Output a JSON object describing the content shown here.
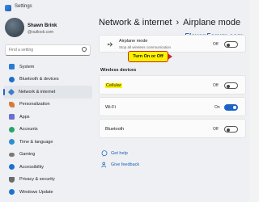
{
  "window": {
    "title": "Settings"
  },
  "user": {
    "name": "Shawn Brink",
    "email": "@outlook.com"
  },
  "search": {
    "placeholder": "Find a setting"
  },
  "sidebar": {
    "items": [
      {
        "label": "System",
        "icon": "system-icon",
        "color": "#2b7bd6"
      },
      {
        "label": "Bluetooth & devices",
        "icon": "bluetooth-icon",
        "color": "#1f6fc9"
      },
      {
        "label": "Network & internet",
        "icon": "network-icon",
        "color": "#3d7cc9"
      },
      {
        "label": "Personalization",
        "icon": "brush-icon",
        "color": "#d97a3a"
      },
      {
        "label": "Apps",
        "icon": "apps-icon",
        "color": "#6b6fcf"
      },
      {
        "label": "Accounts",
        "icon": "accounts-icon",
        "color": "#2aa36b"
      },
      {
        "label": "Time & language",
        "icon": "clock-icon",
        "color": "#2b8fd6"
      },
      {
        "label": "Gaming",
        "icon": "gaming-icon",
        "color": "#7a7a7a"
      },
      {
        "label": "Accessibility",
        "icon": "accessibility-icon",
        "color": "#1d6fd1"
      },
      {
        "label": "Privacy & security",
        "icon": "shield-icon",
        "color": "#6a6a6a"
      },
      {
        "label": "Windows Update",
        "icon": "update-icon",
        "color": "#1a73d1"
      }
    ],
    "active_index": 2
  },
  "header": {
    "parent": "Network & internet",
    "separator": "›",
    "current": "Airplane mode"
  },
  "airplane": {
    "label": "Airplane mode",
    "description": "Stop all wireless communication",
    "state": "Off"
  },
  "wireless": {
    "heading": "Wireless devices",
    "items": [
      {
        "label": "Cellular",
        "state": "Off",
        "on": false
      },
      {
        "label": "Wi-Fi",
        "state": "On",
        "on": true
      },
      {
        "label": "Bluetooth",
        "state": "Off",
        "on": false
      }
    ]
  },
  "callout": {
    "text": "Turn On or Off"
  },
  "links": {
    "help": "Get help",
    "feedback": "Give feedback"
  },
  "watermark": {
    "text": "ElevenForum.com"
  },
  "colors": {
    "accent": "#1a64c8",
    "callout": "#fff200",
    "callout_border": "#c62a2a"
  }
}
